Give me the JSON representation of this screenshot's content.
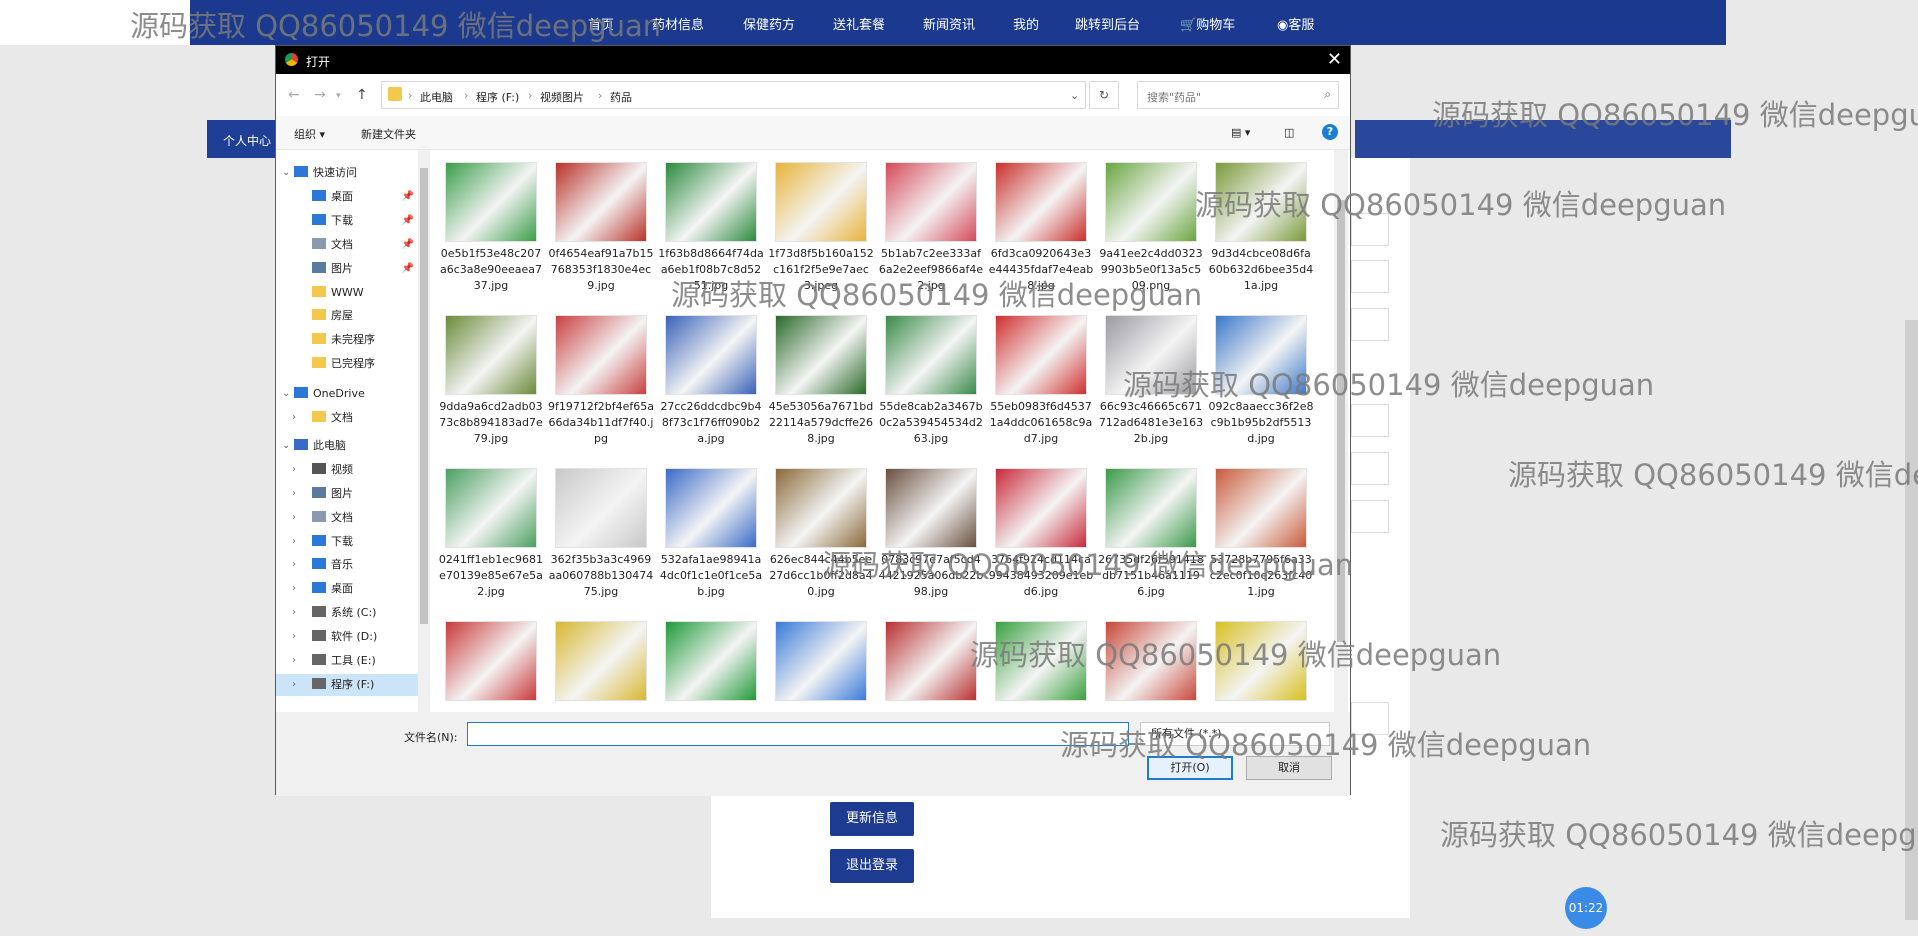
{
  "nav": {
    "items": [
      "首页",
      "药材信息",
      "保健药方",
      "送礼套餐",
      "新闻资讯",
      "我的",
      "跳转到后台",
      "购物车",
      "客服"
    ]
  },
  "page": {
    "left_banner": "个人中心",
    "update_btn": "更新信息",
    "logout_btn": "退出登录",
    "timer": "01:22"
  },
  "watermark": "源码获取 QQ86050149 微信deepguan",
  "dialog": {
    "title": "打开",
    "breadcrumb": [
      "此电脑",
      "程序 (F:)",
      "视频图片",
      "药品"
    ],
    "search_placeholder": "搜索\"药品\"",
    "toolbar": {
      "organize": "组织 ▾",
      "new_folder": "新建文件夹"
    },
    "sidebar": [
      {
        "label": "快速访问",
        "icon": "star-icon",
        "level": 0
      },
      {
        "label": "桌面",
        "icon": "desktop-icon",
        "level": 1
      },
      {
        "label": "下载",
        "icon": "download-icon",
        "level": 1
      },
      {
        "label": "文档",
        "icon": "document-icon",
        "level": 1
      },
      {
        "label": "图片",
        "icon": "picture-icon",
        "level": 1
      },
      {
        "label": "WWW",
        "icon": "folder-icon",
        "level": 1
      },
      {
        "label": "房屋",
        "icon": "folder-icon",
        "level": 1
      },
      {
        "label": "未完程序",
        "icon": "folder-icon",
        "level": 1
      },
      {
        "label": "已完程序",
        "icon": "folder-icon",
        "level": 1
      },
      {
        "label": "OneDrive",
        "icon": "cloud-icon",
        "level": 0
      },
      {
        "label": "文档",
        "icon": "folder-icon",
        "level": 1
      },
      {
        "label": "此电脑",
        "icon": "computer-icon",
        "level": 0
      },
      {
        "label": "视频",
        "icon": "video-icon",
        "level": 1
      },
      {
        "label": "图片",
        "icon": "picture-icon",
        "level": 1
      },
      {
        "label": "文档",
        "icon": "document-icon",
        "level": 1
      },
      {
        "label": "下载",
        "icon": "download-icon",
        "level": 1
      },
      {
        "label": "音乐",
        "icon": "music-icon",
        "level": 1
      },
      {
        "label": "桌面",
        "icon": "desktop-icon",
        "level": 1
      },
      {
        "label": "系统 (C:)",
        "icon": "drive-icon",
        "level": 1
      },
      {
        "label": "软件 (D:)",
        "icon": "drive-icon",
        "level": 1
      },
      {
        "label": "工具 (E:)",
        "icon": "drive-icon",
        "level": 1
      },
      {
        "label": "程序 (F:)",
        "icon": "drive-icon",
        "level": 1,
        "selected": true
      }
    ],
    "files": [
      "0e5b1f53e48c207a6c3a8e90eeaea737.jpg",
      "0f4654eaf91a7b15768353f1830e4ec9.jpg",
      "1f63b8d8664f74daa6eb1f08b7c8d5251.jpg",
      "1f73d8f5b160a152c161f2f5e9e7aec3.jpeg",
      "5b1ab7c2ee333af6a2e2eef9866af4e2.jpg",
      "6fd3ca0920643e3e44435fdaf7e4eab8.jpg",
      "9a41ee2c4dd03239903b5e0f13a5c509.png",
      "9d3d4cbce08d6fa60b632d6bee35d41a.jpg",
      "9dda9a6cd2adb0373c8b894183ad7e79.jpg",
      "9f19712f2bf4ef65a66da34b11df7f40.jpg",
      "27cc26ddcdbc9b48f73c1f76ff090b2a.jpg",
      "45e53056a7671bd22114a579dcffe268.jpg",
      "55de8cab2a3467b0c2a539454534d263.jpg",
      "55eb0983f6d45371a4ddc061658c9ad7.jpg",
      "66c93c46665c671712ad6481e3e1632b.jpg",
      "092c8aaecc36f2e8c9b1b95b2df5513d.jpg",
      "0241ff1eb1ec9681e70139e85e67e5a2.jpg",
      "362f35b3a3c4969aa060788b13047475.jpg",
      "532afa1ae98941a4dc0f1c1e0f1ce5ab.jpg",
      "626ec844c44b5ee27d6cc1b0ff2d8a40.jpg",
      "0783c97e7af5cd44421925a06db22b98.jpg",
      "3764f924cd114ca99438493209e1ebd6.jpg",
      "26735df26f591418db7151b46a11196.jpg",
      "53728b7795f6a33c2ec0f10e263fc401.jpg",
      "",
      "",
      "",
      "",
      "",
      "",
      "",
      ""
    ],
    "thumb_colors": [
      "#3a9d4a",
      "#b8322a",
      "#2b8a3e",
      "#e8b43a",
      "#d44a5a",
      "#c9302c",
      "#6aa640",
      "#7a9a3a",
      "#6a8a3a",
      "#c84040",
      "#3a62b8",
      "#2a6a2a",
      "#3a8a4a",
      "#d03030",
      "#9a9aa0",
      "#3a78c8",
      "#4aa060",
      "#c8c8c8",
      "#3a6ac8",
      "#8a6a3a",
      "#6a5040",
      "#c82a3a",
      "#3a9a4a",
      "#c85a3a",
      "#c83a3a",
      "#d8b830",
      "#1f9a3a",
      "#3a7ad8",
      "#b83030",
      "#3aa040",
      "#c8483a",
      "#d8c020"
    ],
    "filename_label": "文件名(N):",
    "filename_value": "",
    "filter": "所有文件 (*.*)",
    "open_btn": "打开(O)",
    "cancel_btn": "取消"
  }
}
